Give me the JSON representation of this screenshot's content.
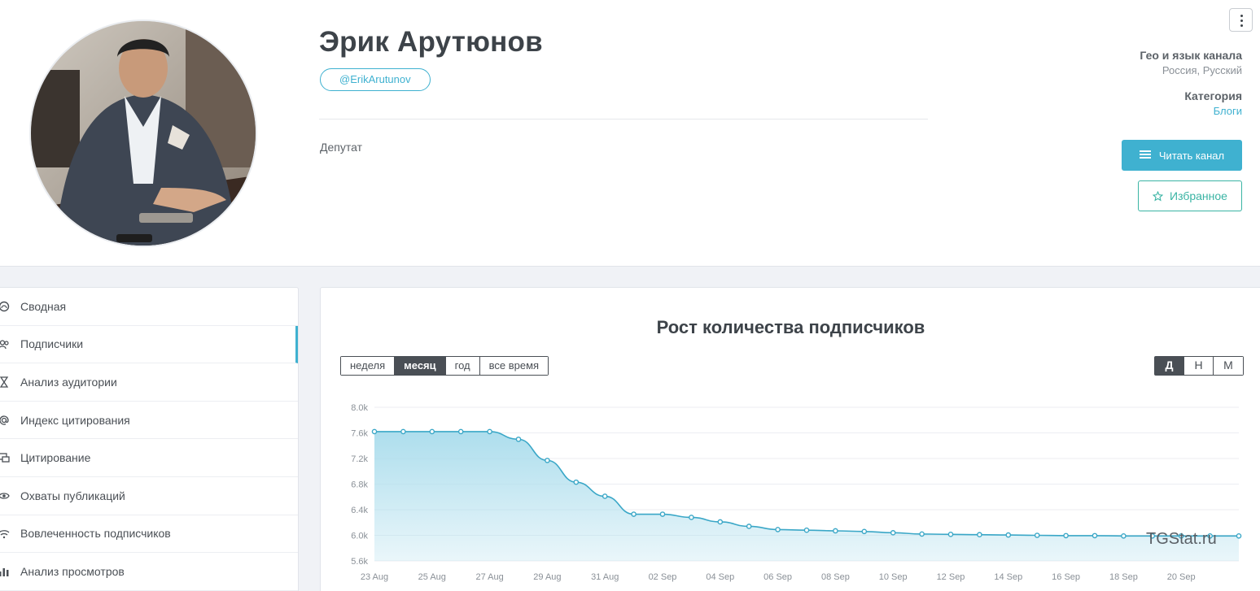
{
  "profile": {
    "name": "Эрик Арутюнов",
    "handle": "@ErikArutunov",
    "description": "Депутат",
    "geo_label": "Гео и язык канала",
    "geo_value": "Россия, Русский",
    "category_label": "Категория",
    "category_value": "Блоги",
    "read_button": "Читать канал",
    "favorite_button": "Избранное"
  },
  "sidebar": {
    "items": [
      {
        "label": "Сводная",
        "icon": "dashboard-icon"
      },
      {
        "label": "Подписчики",
        "icon": "users-icon",
        "active": true
      },
      {
        "label": "Анализ аудитории",
        "icon": "hourglass-icon"
      },
      {
        "label": "Индекс цитирования",
        "icon": "at-icon"
      },
      {
        "label": "Цитирование",
        "icon": "quote-icon"
      },
      {
        "label": "Охваты публикаций",
        "icon": "eye-icon"
      },
      {
        "label": "Вовлеченность подписчиков",
        "icon": "wifi-icon"
      },
      {
        "label": "Анализ просмотров",
        "icon": "bar-chart-icon"
      }
    ]
  },
  "chart_controls": {
    "ranges": [
      "неделя",
      "месяц",
      "год",
      "все время"
    ],
    "selected_range": "месяц",
    "granularity": [
      "Д",
      "Н",
      "М"
    ],
    "selected_granularity": "Д"
  },
  "watermark": "TGStat.ru",
  "colors": {
    "accent": "#3fb1d0",
    "favorite": "#3ab4a4",
    "line": "#3aa7c7",
    "area": "#a9dcec"
  },
  "chart_data": {
    "type": "area",
    "title": "Рост количества подписчиков",
    "x": [
      "23 Aug",
      "24 Aug",
      "25 Aug",
      "26 Aug",
      "27 Aug",
      "28 Aug",
      "29 Aug",
      "30 Aug",
      "31 Aug",
      "01 Sep",
      "02 Sep",
      "03 Sep",
      "04 Sep",
      "05 Sep",
      "06 Sep",
      "07 Sep",
      "08 Sep",
      "09 Sep",
      "10 Sep",
      "11 Sep",
      "12 Sep",
      "13 Sep",
      "14 Sep",
      "15 Sep",
      "16 Sep",
      "17 Sep",
      "18 Sep",
      "19 Sep",
      "20 Sep",
      "21 Sep",
      "22 Sep"
    ],
    "x_tick_labels": [
      "23 Aug",
      "25 Aug",
      "27 Aug",
      "29 Aug",
      "31 Aug",
      "02 Sep",
      "04 Sep",
      "06 Sep",
      "08 Sep",
      "10 Sep",
      "12 Sep",
      "14 Sep",
      "16 Sep",
      "18 Sep",
      "20 Sep"
    ],
    "y": [
      7620,
      7620,
      7620,
      7620,
      7620,
      7500,
      7170,
      6830,
      6610,
      6330,
      6330,
      6280,
      6210,
      6140,
      6090,
      6080,
      6070,
      6060,
      6040,
      6020,
      6015,
      6010,
      6005,
      6000,
      5995,
      5995,
      5990,
      5990,
      5990,
      5990,
      5990
    ],
    "y_ticks": [
      "5.6k",
      "6.0k",
      "6.4k",
      "6.8k",
      "7.2k",
      "7.6k",
      "8.0k"
    ],
    "ylim": [
      5600,
      8000
    ],
    "grid": true
  }
}
